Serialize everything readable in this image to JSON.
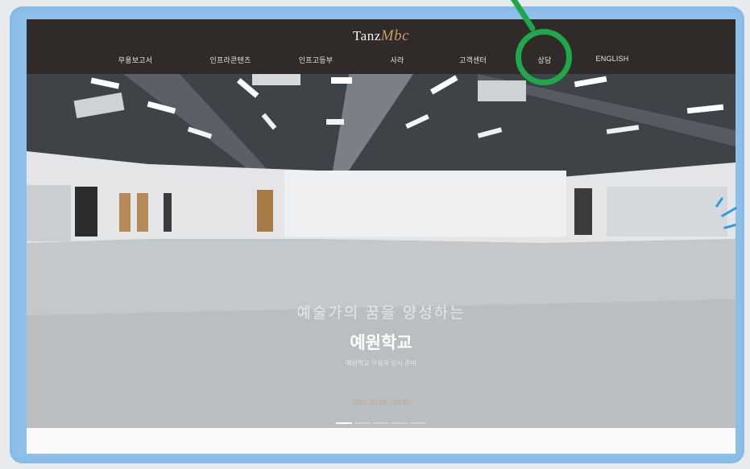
{
  "site": {
    "logo_main": "Tanz",
    "logo_accent": "Mbc"
  },
  "nav": {
    "items": [
      {
        "label": "무용보고서"
      },
      {
        "label": "인프라콘텐츠"
      },
      {
        "label": "인프고등부"
      },
      {
        "label": "사라"
      },
      {
        "label": "고객센터"
      },
      {
        "label": "상담"
      },
      {
        "label": "ENGLISH"
      }
    ],
    "highlighted_index": 5
  },
  "hero": {
    "line1": "예술가의 꿈을 양성하는",
    "line2": "예원학교",
    "line3": "예원학교 무용과 입시 준비",
    "date": "2016. 07.24 ~ 08.40",
    "slide_count": 5,
    "active_slide": 0
  },
  "annotation": {
    "circle_color": "#1ea84a",
    "spark_color": "#2b9be8"
  }
}
